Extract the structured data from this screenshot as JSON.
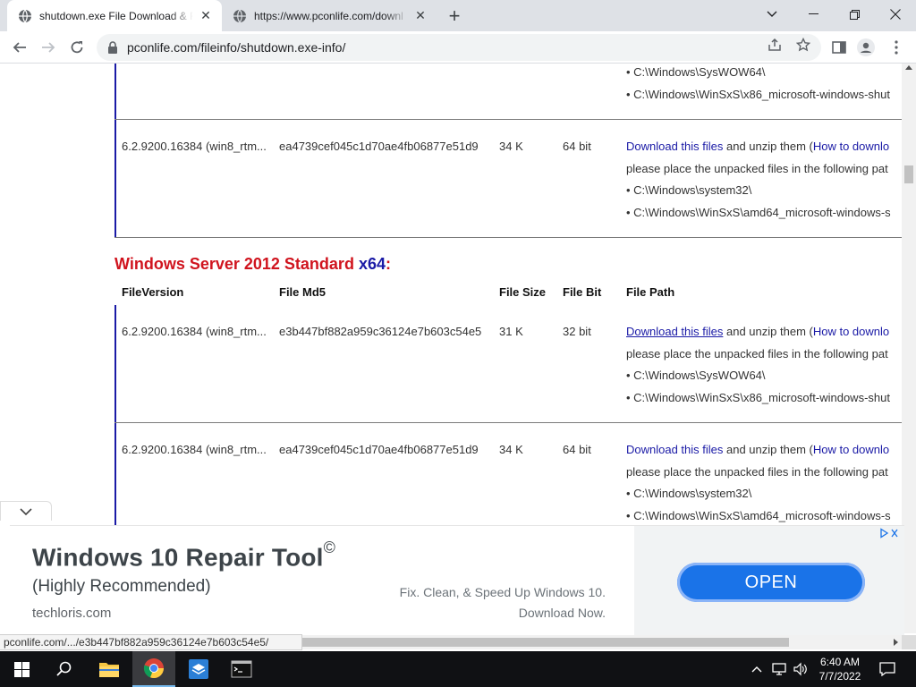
{
  "browser": {
    "tabs": [
      {
        "title": "shutdown.exe File Download & F",
        "active": true
      },
      {
        "title": "https://www.pconlife.com/downl",
        "active": false
      }
    ],
    "url": "pconlife.com/fileinfo/shutdown.exe-info/",
    "window_controls": {
      "minimize": "minimize-icon",
      "maximize": "restore-icon",
      "close": "close-icon"
    }
  },
  "top_fragment": {
    "paths": [
      "• C:\\Windows\\SysWOW64\\",
      "• C:\\Windows\\WinSxS\\x86_microsoft-windows-shut"
    ]
  },
  "row_before": {
    "version": "6.2.9200.16384 (win8_rtm...",
    "md5": "ea4739cef045c1d70ae4fb06877e51d9",
    "size": "34 K",
    "bit": "64 bit",
    "download_link": "Download this files",
    "download_rest": " and unzip them (",
    "howto_link": "How to downlo",
    "place_text": "please place the unpacked files in the following pat",
    "paths": [
      "• C:\\Windows\\system32\\",
      "• C:\\Windows\\WinSxS\\amd64_microsoft-windows-s"
    ]
  },
  "section": {
    "title": "Windows Server 2012 Standard ",
    "arch": "x64",
    "colon": ":"
  },
  "table_headers": {
    "version": "FileVersion",
    "md5": "File Md5",
    "size": "File Size",
    "bit": "File Bit",
    "path": "File Path"
  },
  "rows": [
    {
      "version": "6.2.9200.16384 (win8_rtm...",
      "md5": "e3b447bf882a959c36124e7b603c54e5",
      "size": "31 K",
      "bit": "32 bit",
      "download_link": "Download this files",
      "download_rest": " and unzip them (",
      "howto_link": "How to downlo",
      "place_text": "please place the unpacked files in the following pat",
      "paths": [
        "• C:\\Windows\\SysWOW64\\",
        "• C:\\Windows\\WinSxS\\x86_microsoft-windows-shut"
      ]
    },
    {
      "version": "6.2.9200.16384 (win8_rtm...",
      "md5": "ea4739cef045c1d70ae4fb06877e51d9",
      "size": "34 K",
      "bit": "64 bit",
      "download_link": "Download this files",
      "download_rest": " and unzip them (",
      "howto_link": "How to downlo",
      "place_text": "please place the unpacked files in the following pat",
      "paths": [
        "• C:\\Windows\\system32\\",
        "• C:\\Windows\\WinSxS\\amd64_microsoft-windows-s"
      ]
    }
  ],
  "ad": {
    "title": "Windows 10 Repair Tool",
    "title_mark": "©",
    "subtitle": "(Highly Recommended)",
    "domain": "techloris.com",
    "copy_line1": "Fix. Clean, & Speed Up Windows 10.",
    "copy_line2": "Download Now.",
    "button": "OPEN",
    "choices_icon": "adchoices-icon"
  },
  "status_bar": "pconlife.com/.../e3b447bf882a959c36124e7b603c54e5/",
  "taskbar": {
    "apps": [
      "start-icon",
      "search-icon",
      "file-explorer-icon",
      "chrome-icon",
      "app-icon",
      "terminal-icon"
    ],
    "time": "6:40 AM",
    "date": "7/7/2022"
  }
}
